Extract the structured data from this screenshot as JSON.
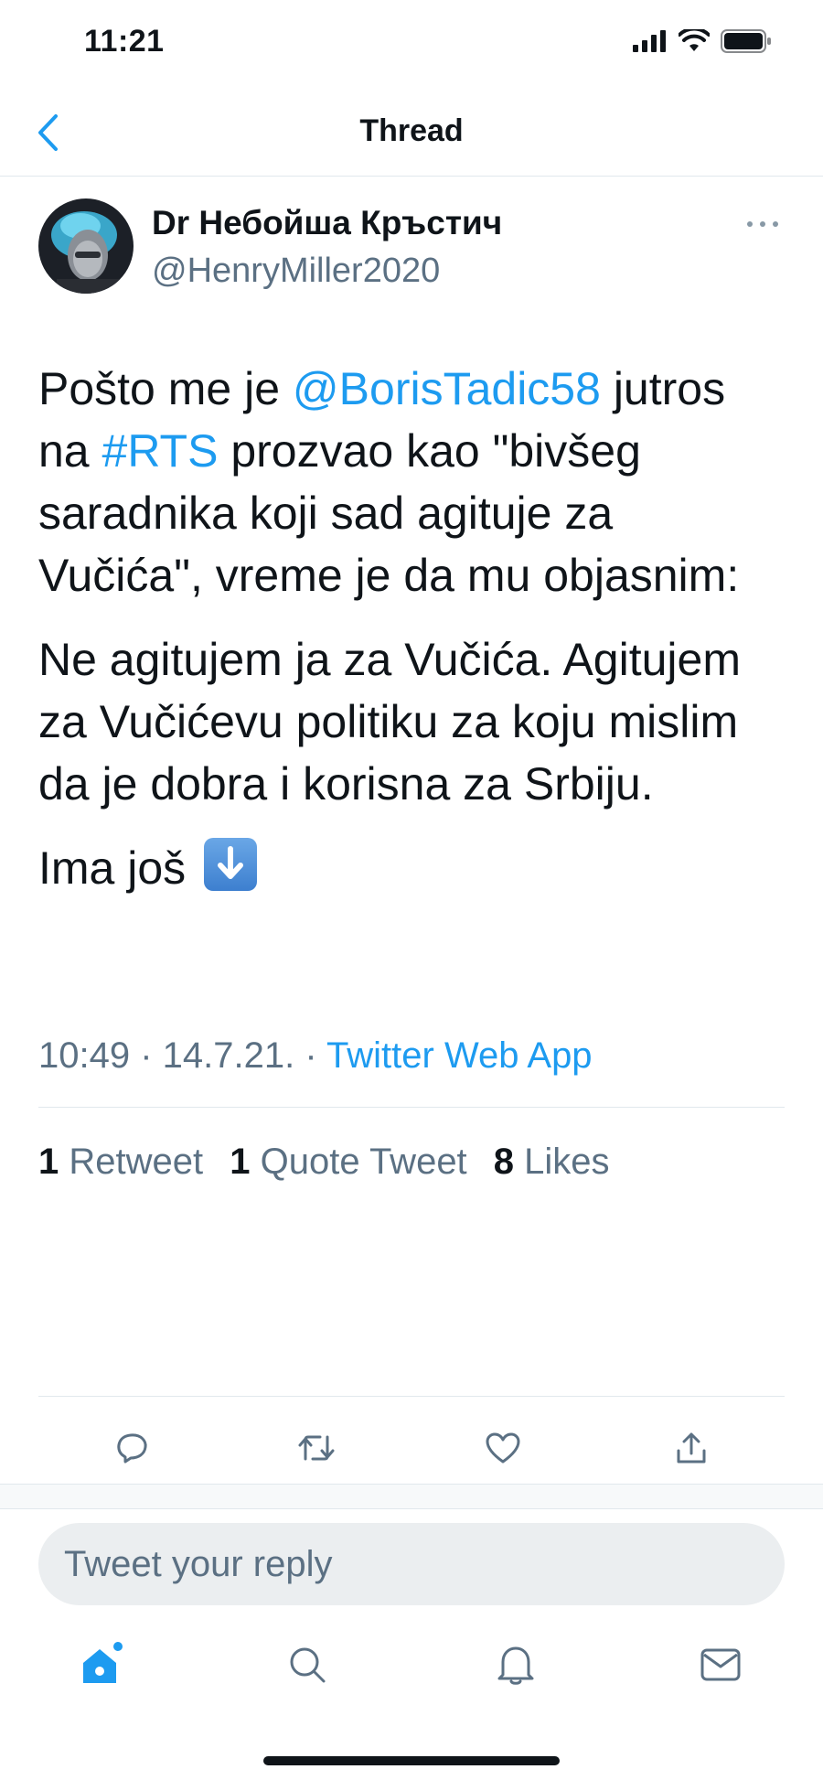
{
  "status_bar": {
    "time": "11:21"
  },
  "header": {
    "title": "Thread"
  },
  "tweet": {
    "author_name": "Dr Небойша Кръстич",
    "author_handle": "@HenryMiller2020",
    "body": {
      "p1_part1": "Pošto me je ",
      "p1_mention": "@BorisTadic58",
      "p1_part2": " jutros na ",
      "p1_hashtag": "#RTS",
      "p1_part3": " prozvao kao \"bivšeg saradnika koji sad agituje za Vučića\", vreme je da mu objasnim:",
      "p2": "Ne agitujem ja za Vučića. Agitujem za Vučićevu politiku za koju mislim da je dobra i korisna za Srbiju.",
      "p3": "Ima još"
    },
    "timestamp": "10:49 · 14.7.21. · ",
    "source": "Twitter Web App",
    "stats": {
      "retweets_count": "1",
      "retweets_label": " Retweet",
      "quotes_count": "1",
      "quotes_label": " Quote Tweet",
      "likes_count": "8",
      "likes_label": " Likes"
    }
  },
  "reply": {
    "placeholder": "Tweet your reply"
  },
  "icons": {
    "back": "chevron-left-icon",
    "more": "more-horizontal-icon",
    "reply": "reply-icon",
    "retweet": "retweet-icon",
    "like": "heart-icon",
    "share": "share-icon",
    "home": "home-icon",
    "search": "search-icon",
    "notifications": "bell-icon",
    "messages": "mail-icon",
    "emoji": "down-arrow-emoji"
  },
  "colors": {
    "accent": "#1d9bf0",
    "secondary_text": "#5b7083",
    "text": "#0f1419"
  }
}
